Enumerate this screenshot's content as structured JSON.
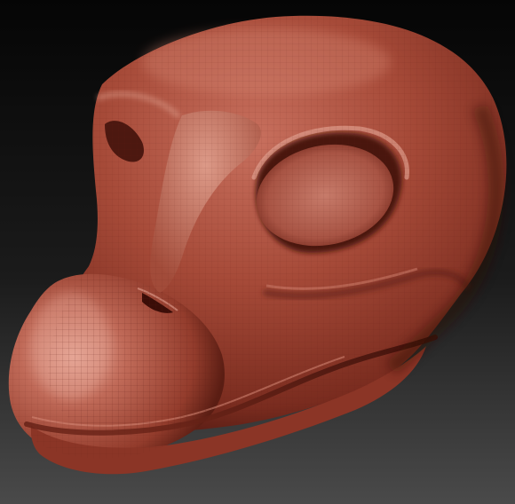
{
  "scene": {
    "subject": "sculpted-creature-head-render",
    "colors": {
      "background_top": "#050505",
      "background_bottom": "#4a4a4a",
      "clay_base": "#9a3d2e",
      "clay_light": "#d07a68",
      "clay_highlight": "#e9a594",
      "clay_shadow": "#4a1610",
      "clay_deep_shadow": "#2a0a06",
      "wire_lines": "#7a2a1e"
    }
  }
}
